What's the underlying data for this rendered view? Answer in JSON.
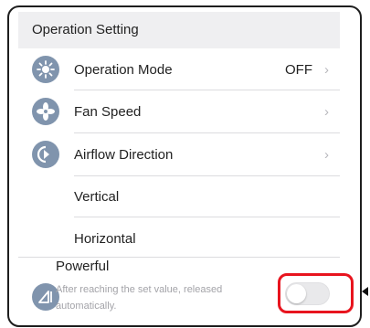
{
  "section": {
    "title": "Operation Setting"
  },
  "rows": [
    {
      "label": "Operation Mode",
      "value": "OFF",
      "chevron": "›",
      "icon": "operation-mode-icon"
    },
    {
      "label": "Fan Speed",
      "value": "",
      "chevron": "›",
      "icon": "fan-icon"
    },
    {
      "label": "Airflow Direction",
      "value": "",
      "chevron": "›",
      "icon": "airflow-icon"
    }
  ],
  "airflow_sub": [
    {
      "label": "Vertical"
    },
    {
      "label": "Horizontal"
    }
  ],
  "powerful": {
    "label": "Powerful",
    "description": "After reaching the set value, released automatically.",
    "toggle_on": false,
    "icon": "powerful-icon"
  },
  "colors": {
    "icon_bg": "#8094ad",
    "highlight": "#e8141e",
    "header_bg": "#efeff1"
  }
}
